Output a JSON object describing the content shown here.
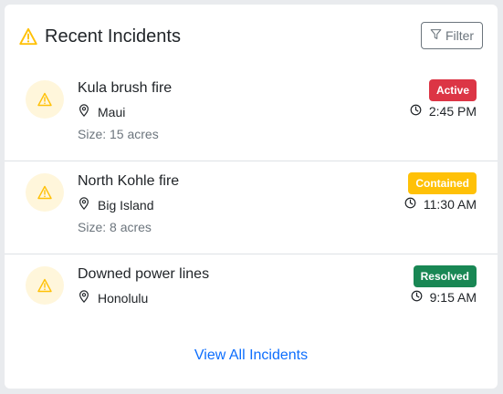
{
  "header": {
    "title": "Recent Incidents",
    "filter_label": "Filter"
  },
  "incidents": [
    {
      "title": "Kula brush fire",
      "location": "Maui",
      "size": "Size: 15 acres",
      "status": "Active",
      "status_color": "#dc3545",
      "time": "2:45 PM"
    },
    {
      "title": "North Kohle fire",
      "location": "Big Island",
      "size": "Size: 8 acres",
      "status": "Contained",
      "status_color": "#ffc107",
      "time": "11:30 AM"
    },
    {
      "title": "Downed power lines",
      "location": "Honolulu",
      "size": "",
      "status": "Resolved",
      "status_color": "#198754",
      "time": "9:15 AM"
    }
  ],
  "footer": {
    "view_all_label": "View All Incidents"
  },
  "colors": {
    "warning_icon": "#ffc107",
    "link": "#0d6efd"
  }
}
